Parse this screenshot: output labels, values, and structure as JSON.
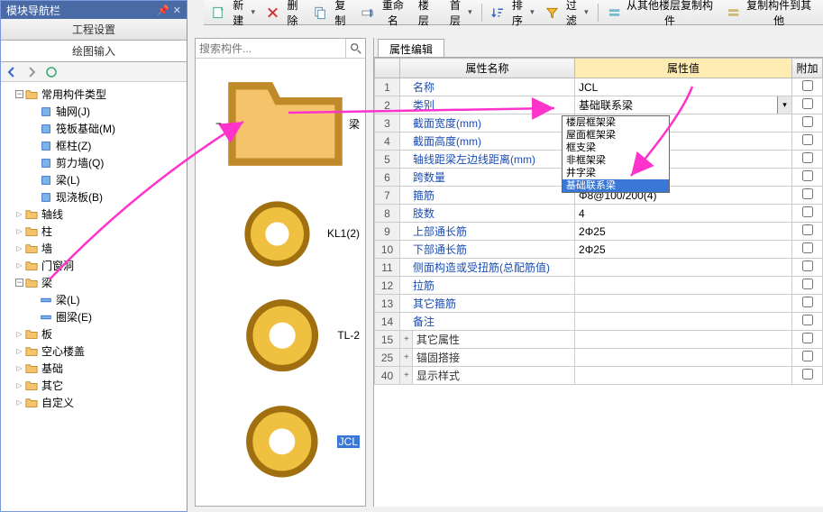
{
  "left_panel": {
    "title": "模块导航栏",
    "tab1": "工程设置",
    "tab2": "绘图输入"
  },
  "tree": {
    "root": "常用构件类型",
    "items": [
      {
        "label": "轴网(J)"
      },
      {
        "label": "筏板基础(M)"
      },
      {
        "label": "框柱(Z)"
      },
      {
        "label": "剪力墙(Q)"
      },
      {
        "label": "梁(L)"
      },
      {
        "label": "现浇板(B)"
      }
    ],
    "groups": [
      {
        "label": "轴线"
      },
      {
        "label": "柱"
      },
      {
        "label": "墙"
      },
      {
        "label": "门窗洞"
      },
      {
        "label": "梁",
        "expanded": true,
        "children": [
          {
            "label": "梁(L)"
          },
          {
            "label": "圈梁(E)"
          }
        ]
      },
      {
        "label": "板"
      },
      {
        "label": "空心楼盖"
      },
      {
        "label": "基础"
      },
      {
        "label": "其它"
      },
      {
        "label": "自定义"
      }
    ]
  },
  "toolbar": {
    "new": "新建",
    "del": "删除",
    "copy": "复制",
    "rename": "重命名",
    "floor": "楼层",
    "floor_val": "首层",
    "sort": "排序",
    "filter": "过滤",
    "copy_from": "从其他楼层复制构件",
    "copy_to": "复制构件到其他"
  },
  "search": {
    "placeholder": "搜索构件..."
  },
  "mid_tree": {
    "root": "梁",
    "items": [
      {
        "label": "KL1(2)"
      },
      {
        "label": "TL-2"
      },
      {
        "label": "JCL",
        "selected": true
      }
    ]
  },
  "prop_panel": {
    "tab": "属性编辑",
    "col_name": "属性名称",
    "col_value": "属性值",
    "col_extra": "附加"
  },
  "props": [
    {
      "n": "1",
      "name": "名称",
      "val": "JCL",
      "chk": false,
      "blue": true
    },
    {
      "n": "2",
      "name": "类别",
      "val": "基础联系梁",
      "chk": false,
      "blue": true,
      "selected": true,
      "dropdown": true
    },
    {
      "n": "3",
      "name": "截面宽度(mm)",
      "val": "",
      "chk": false,
      "blue": true
    },
    {
      "n": "4",
      "name": "截面高度(mm)",
      "val": "",
      "chk": false,
      "blue": true
    },
    {
      "n": "5",
      "name": "轴线距梁左边线距离(mm)",
      "val": "",
      "chk": false,
      "blue": true
    },
    {
      "n": "6",
      "name": "跨数量",
      "val": "",
      "chk": false,
      "blue": true
    },
    {
      "n": "7",
      "name": "箍筋",
      "val": "Φ8@100/200(4)",
      "chk": false,
      "blue": true
    },
    {
      "n": "8",
      "name": "肢数",
      "val": "4",
      "chk": false,
      "blue": true
    },
    {
      "n": "9",
      "name": "上部通长筋",
      "val": "2Φ25",
      "chk": false,
      "blue": true
    },
    {
      "n": "10",
      "name": "下部通长筋",
      "val": "2Φ25",
      "chk": false,
      "blue": true
    },
    {
      "n": "11",
      "name": "侧面构造或受扭筋(总配筋值)",
      "val": "",
      "chk": false,
      "blue": true
    },
    {
      "n": "12",
      "name": "拉筋",
      "val": "",
      "chk": false,
      "blue": true
    },
    {
      "n": "13",
      "name": "其它箍筋",
      "val": "",
      "chk": false,
      "blue": true
    },
    {
      "n": "14",
      "name": "备注",
      "val": "",
      "chk": false,
      "blue": true
    },
    {
      "n": "15",
      "name": "其它属性",
      "val": "",
      "chk": false,
      "blue": false,
      "exp": "+"
    },
    {
      "n": "25",
      "name": "锚固搭接",
      "val": "",
      "chk": false,
      "blue": false,
      "exp": "+"
    },
    {
      "n": "40",
      "name": "显示样式",
      "val": "",
      "chk": false,
      "blue": false,
      "exp": "+"
    }
  ],
  "dropdown": {
    "options": [
      "楼层框架梁",
      "屋面框架梁",
      "框支梁",
      "非框架梁",
      "井字梁",
      "基础联系梁"
    ],
    "selected": "基础联系梁"
  }
}
